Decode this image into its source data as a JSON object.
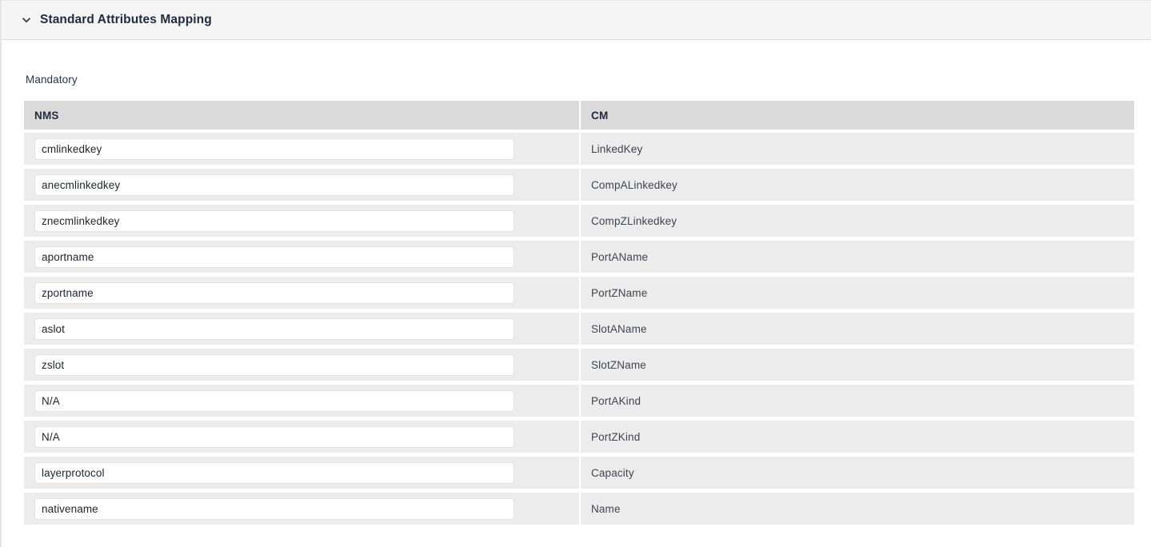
{
  "section": {
    "title": "Standard Attributes Mapping",
    "collapse_icon": "chevron-down-icon",
    "expanded": true
  },
  "group": {
    "label": "Mandatory"
  },
  "table": {
    "columns": [
      {
        "key": "nms",
        "header": "NMS"
      },
      {
        "key": "cm",
        "header": "CM"
      }
    ],
    "rows": [
      {
        "nms": "cmlinkedkey",
        "cm": "LinkedKey"
      },
      {
        "nms": "anecmlinkedkey",
        "cm": "CompALinkedkey"
      },
      {
        "nms": "znecmlinkedkey",
        "cm": "CompZLinkedkey"
      },
      {
        "nms": "aportname",
        "cm": "PortAName"
      },
      {
        "nms": "zportname",
        "cm": "PortZName"
      },
      {
        "nms": "aslot",
        "cm": "SlotAName"
      },
      {
        "nms": "zslot",
        "cm": "SlotZName"
      },
      {
        "nms": "N/A",
        "cm": "PortAKind"
      },
      {
        "nms": "N/A",
        "cm": "PortZKind"
      },
      {
        "nms": "layerprotocol",
        "cm": "Capacity"
      },
      {
        "nms": "nativename",
        "cm": "Name"
      }
    ]
  },
  "colors": {
    "page_background": "#ffffff",
    "header_background": "#f5f5f5",
    "column_header_background": "#dadada",
    "row_background": "#ececec",
    "input_background": "#ffffff",
    "input_border": "#e8e0da",
    "text_primary": "#1f2a3c",
    "text_secondary": "#3f4451"
  }
}
